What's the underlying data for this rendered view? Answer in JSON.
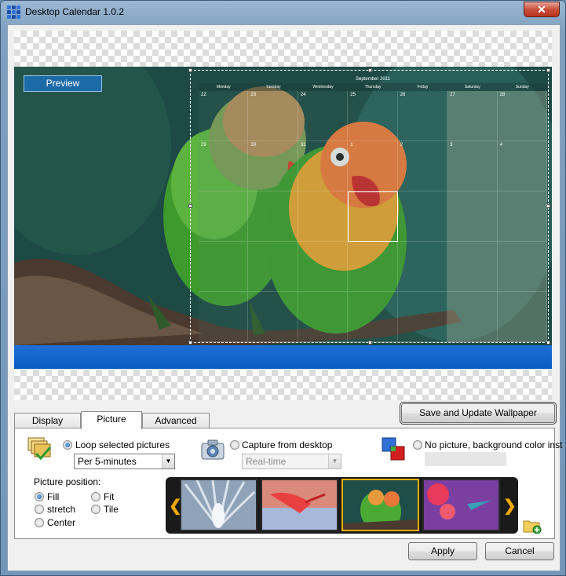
{
  "window": {
    "title": "Desktop Calendar 1.0.2",
    "close_glyph": "✕"
  },
  "preview": {
    "button_label": "Preview",
    "calendar_title": "September 2011",
    "weekdays": [
      "Monday",
      "Tuesday",
      "Wednesday",
      "Thursday",
      "Friday",
      "Saturday",
      "Sunday"
    ],
    "weeks": [
      [
        "22",
        "23",
        "24",
        "25",
        "26",
        "27",
        "28"
      ],
      [
        "29",
        "30",
        "31",
        "1",
        "2",
        "3",
        "4"
      ],
      [
        "",
        "",
        "",
        "",
        "",
        "",
        ""
      ],
      [
        "",
        "",
        "",
        "",
        "",
        "",
        ""
      ],
      [
        "",
        "",
        "",
        "",
        "",
        "",
        ""
      ]
    ]
  },
  "tabs": [
    {
      "label": "Display"
    },
    {
      "label": "Picture",
      "active": true
    },
    {
      "label": "Advanced"
    }
  ],
  "save_button": "Save and Update Wallpaper",
  "picture": {
    "loop": {
      "label": "Loop selected pictures",
      "selected": true,
      "interval": "Per 5-minutes",
      "icon": "pictures-icon"
    },
    "capture": {
      "label": "Capture from desktop",
      "selected": false,
      "mode": "Real-time",
      "icon": "camera-icon"
    },
    "nocolor": {
      "label": "No picture, background color inst",
      "selected": false,
      "icon": "color-squares-icon",
      "color": "#e6e6e6"
    },
    "position_heading": "Picture position:",
    "positions": [
      {
        "label": "Fill",
        "selected": true
      },
      {
        "label": "Fit",
        "selected": false
      },
      {
        "label": "stretch",
        "selected": false
      },
      {
        "label": "Tile",
        "selected": false
      },
      {
        "label": "Center",
        "selected": false
      }
    ],
    "thumbnails": [
      {
        "name": "white-peacock",
        "selected": false
      },
      {
        "name": "flamingo",
        "selected": false
      },
      {
        "name": "lovebirds",
        "selected": true
      },
      {
        "name": "hummingbird",
        "selected": false
      }
    ],
    "prev_glyph": "❮",
    "next_glyph": "❯"
  },
  "footer": {
    "apply": "Apply",
    "cancel": "Cancel"
  },
  "colors": {
    "accent": "#1c6aa8",
    "taskbar": "#0c5bc4",
    "selection": "#f0b000"
  }
}
